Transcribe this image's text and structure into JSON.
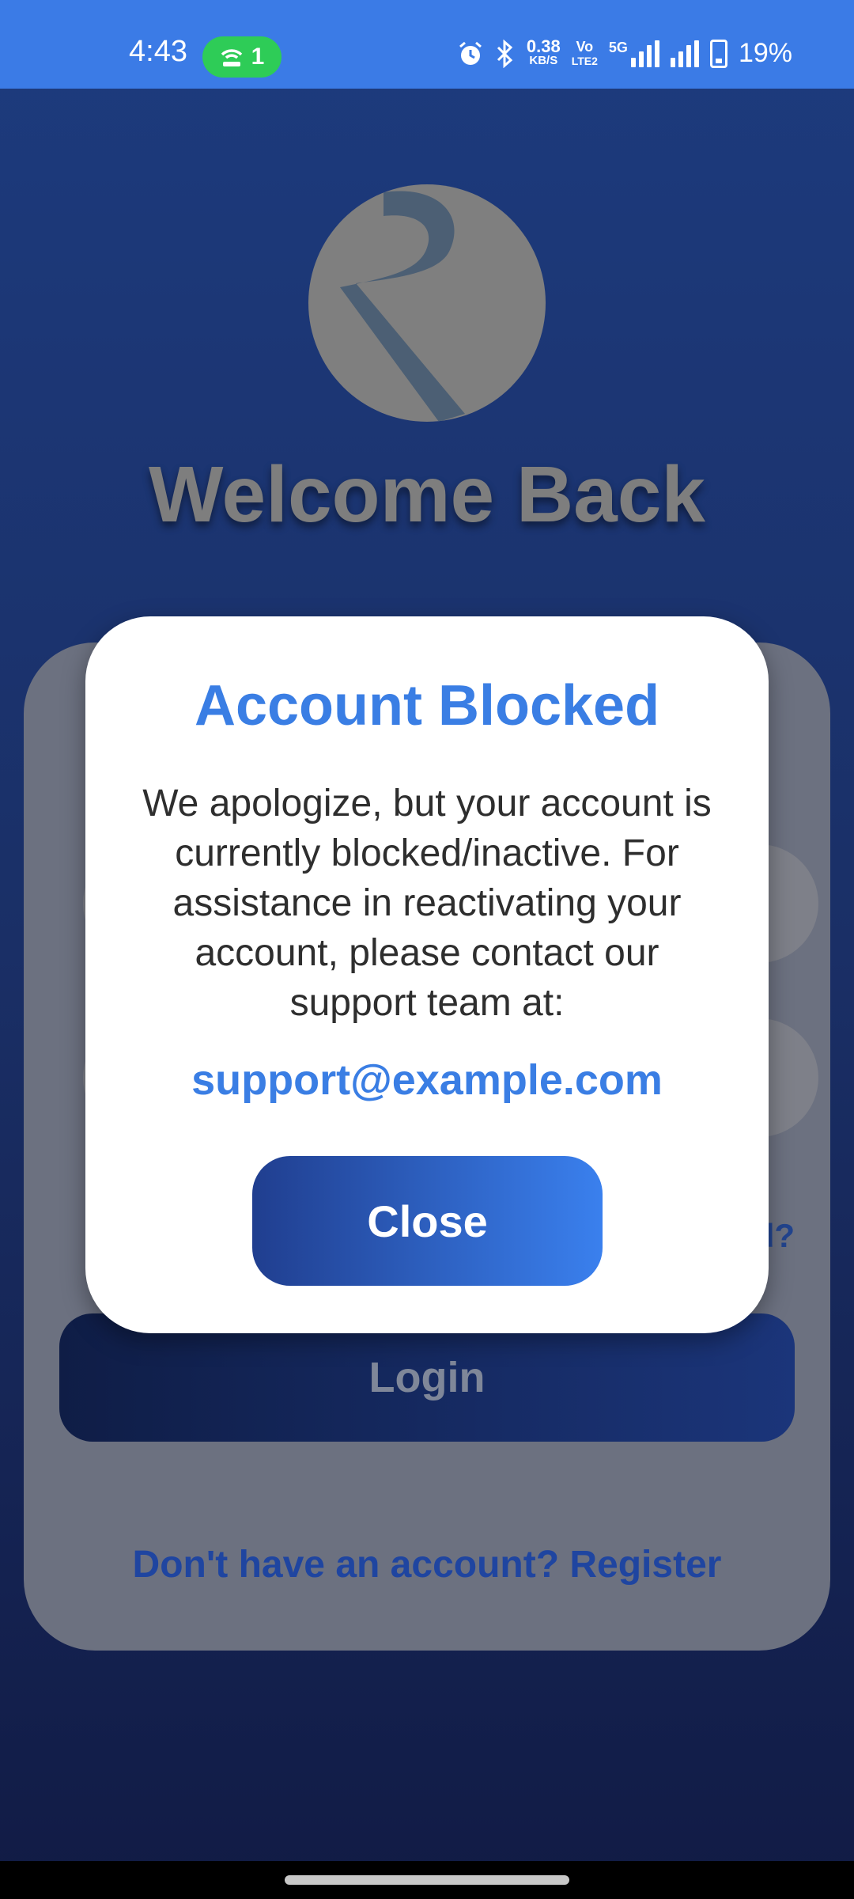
{
  "status_bar": {
    "time": "4:43",
    "hotspot_count": "1",
    "net_speed_value": "0.38",
    "net_speed_unit": "KB/S",
    "volte_top": "Vo",
    "volte_bottom": "LTE2",
    "network_type": "5G",
    "battery_percent": "19%"
  },
  "welcome": {
    "title": "Welcome Back"
  },
  "login_card": {
    "forgot_label_fragment": "d?",
    "login_label": "Login",
    "register_label": "Don't have an account? Register"
  },
  "modal": {
    "title": "Account Blocked",
    "message": "We apologize, but your account is currently blocked/inactive. For assistance in reactivating your account, please contact our support team at:",
    "email": "support@example.com",
    "close_label": "Close"
  },
  "colors": {
    "accent": "#3a7ee4",
    "background_top": "#1d3b7e",
    "background_bottom": "#111b45",
    "hotspot_pill": "#2ecc57"
  }
}
